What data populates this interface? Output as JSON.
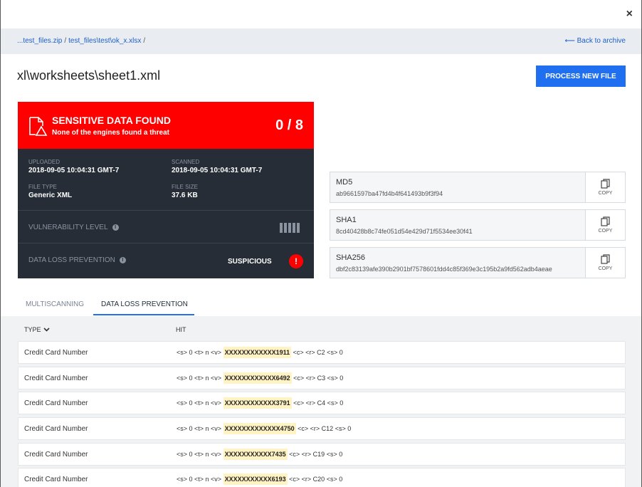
{
  "close_label": "×",
  "breadcrumb": [
    "...test_files.zip",
    "test_files\\test\\ok_x.xlsx"
  ],
  "breadcrumb_sep": "/",
  "back_label": "⟵ Back to archive",
  "title": "xl\\worksheets\\sheet1.xml",
  "process_button": "PROCESS NEW FILE",
  "result": {
    "headline": "SENSITIVE DATA FOUND",
    "subline": "None of the engines found a threat",
    "score": "0 / 8",
    "color": "#ff0000"
  },
  "meta": {
    "uploaded_label": "UPLOADED",
    "uploaded": "2018-09-05 10:04:31 GMT-7",
    "scanned_label": "SCANNED",
    "scanned": "2018-09-05 10:04:31 GMT-7",
    "filetype_label": "FILE TYPE",
    "filetype": "Generic XML",
    "filesize_label": "FILE SIZE",
    "filesize": "37.6 KB"
  },
  "vulnerability_label": "VULNERABILITY LEVEL",
  "dlp_label": "DATA LOSS PREVENTION",
  "dlp_status": "SUSPICIOUS",
  "alert_glyph": "!",
  "info_glyph": "i",
  "hashes": [
    {
      "label": "MD5",
      "value": "ab9661597ba47fd4b4f641493b9f3f94",
      "copy": "COPY"
    },
    {
      "label": "SHA1",
      "value": "8cd40428b8c74fe051d54e429d71f5534ee30f41",
      "copy": "COPY"
    },
    {
      "label": "SHA256",
      "value": "dbf2c83139afe390b2901bf7578601fdd4c85f369e3c195b2a9fd562adb4aeae",
      "copy": "COPY"
    }
  ],
  "tabs": [
    "MULTISCANNING",
    "DATA LOSS PREVENTION"
  ],
  "active_tab": 1,
  "columns": {
    "type": "TYPE",
    "hit": "HIT"
  },
  "rows": [
    {
      "type": "Credit Card Number",
      "pre": "<s> 0 <t> n <v>",
      "hit": "XXXXXXXXXXXX1911",
      "post": "<c> <r> C2 <s> 0"
    },
    {
      "type": "Credit Card Number",
      "pre": "<s> 0 <t> n <v>",
      "hit": "XXXXXXXXXXXX6492",
      "post": "<c> <r> C3 <s> 0"
    },
    {
      "type": "Credit Card Number",
      "pre": "<s> 0 <t> n <v>",
      "hit": "XXXXXXXXXXXX3791",
      "post": "<c> <r> C4 <s> 0"
    },
    {
      "type": "Credit Card Number",
      "pre": "<s> 0 <t> n <v>",
      "hit": "XXXXXXXXXXXXX4750",
      "post": "<c> <r> C12 <s> 0"
    },
    {
      "type": "Credit Card Number",
      "pre": "<s> 0 <t> n <v>",
      "hit": "XXXXXXXXXXX7435",
      "post": "<c> <r> C19 <s> 0"
    },
    {
      "type": "Credit Card Number",
      "pre": "<s> 0 <t> n <v>",
      "hit": "XXXXXXXXXXX6193",
      "post": "<c> <r> C20 <s> 0"
    }
  ]
}
